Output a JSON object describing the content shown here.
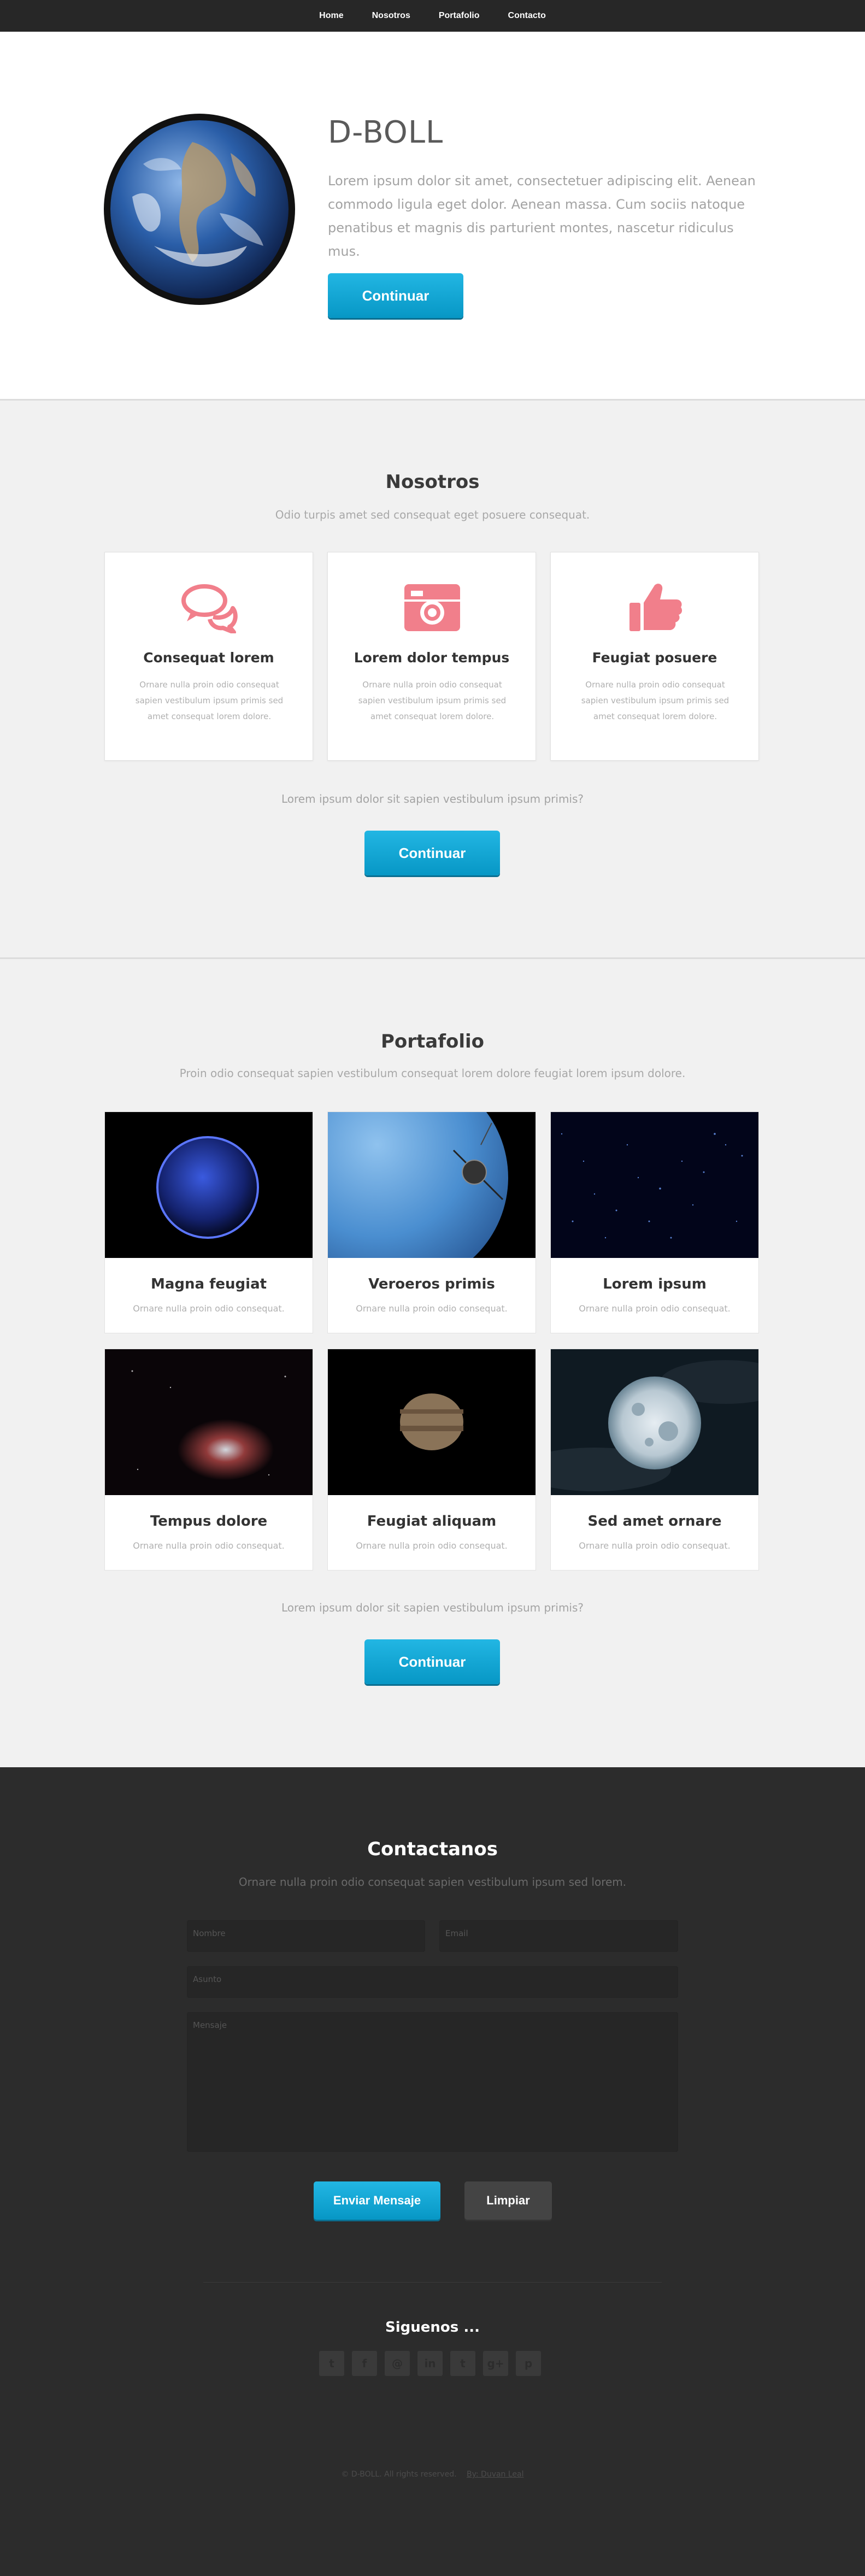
{
  "nav": {
    "items": [
      "Home",
      "Nosotros",
      "Portafolio",
      "Contacto"
    ]
  },
  "hero": {
    "title": "D-BOLL",
    "text": "Lorem ipsum dolor sit amet, consectetuer adipiscing elit. Aenean commodo ligula eget dolor. Aenean massa. Cum sociis natoque penatibus et magnis dis parturient montes, nascetur ridiculus mus.",
    "button": "Continuar"
  },
  "nosotros": {
    "title": "Nosotros",
    "subtitle": "Odio turpis amet sed consequat eget posuere consequat.",
    "cards": [
      {
        "icon": "chat-bubbles-icon",
        "title": "Consequat lorem",
        "text": "Ornare nulla proin odio consequat sapien vestibulum ipsum primis sed amet consequat lorem dolore."
      },
      {
        "icon": "camera-icon",
        "title": "Lorem dolor tempus",
        "text": "Ornare nulla proin odio consequat sapien vestibulum ipsum primis sed amet consequat lorem dolore."
      },
      {
        "icon": "thumbs-up-icon",
        "title": "Feugiat posuere",
        "text": "Ornare nulla proin odio consequat sapien vestibulum ipsum primis sed amet consequat lorem dolore."
      }
    ],
    "question": "Lorem ipsum dolor sit sapien vestibulum ipsum primis?",
    "button": "Continuar"
  },
  "portafolio": {
    "title": "Portafolio",
    "subtitle": "Proin odio consequat sapien vestibulum consequat lorem dolore feugiat lorem ipsum dolore.",
    "items": [
      {
        "title": "Magna feugiat",
        "text": "Ornare nulla proin odio consequat."
      },
      {
        "title": "Veroeros primis",
        "text": "Ornare nulla proin odio consequat."
      },
      {
        "title": "Lorem ipsum",
        "text": "Ornare nulla proin odio consequat."
      },
      {
        "title": "Tempus dolore",
        "text": "Ornare nulla proin odio consequat."
      },
      {
        "title": "Feugiat aliquam",
        "text": "Ornare nulla proin odio consequat."
      },
      {
        "title": "Sed amet ornare",
        "text": "Ornare nulla proin odio consequat."
      }
    ],
    "question": "Lorem ipsum dolor sit sapien vestibulum ipsum primis?",
    "button": "Continuar"
  },
  "contacto": {
    "title": "Contactanos",
    "subtitle": "Ornare nulla proin odio consequat sapien vestibulum ipsum sed lorem.",
    "name_placeholder": "Nombre",
    "email_placeholder": "Email",
    "subject_placeholder": "Asunto",
    "message_placeholder": "Mensaje",
    "send_button": "Enviar Mensaje",
    "clear_button": "Limpiar",
    "follow_title": "Siguenos ...",
    "socials": [
      "twitter-icon",
      "facebook-icon",
      "email-icon",
      "linkedin-icon",
      "tumblr-icon",
      "google-plus-icon",
      "pinterest-icon"
    ],
    "social_glyphs": [
      "t",
      "f",
      "@",
      "in",
      "t",
      "g+",
      "p"
    ]
  },
  "footer": {
    "copyright": "© D-BOLL. All rights reserved.",
    "credit": "By: Duvan Leal"
  },
  "colors": {
    "accent": "#11a6d6",
    "card_icon": "#f17f8b",
    "dark_bg": "#2c2c2c"
  }
}
